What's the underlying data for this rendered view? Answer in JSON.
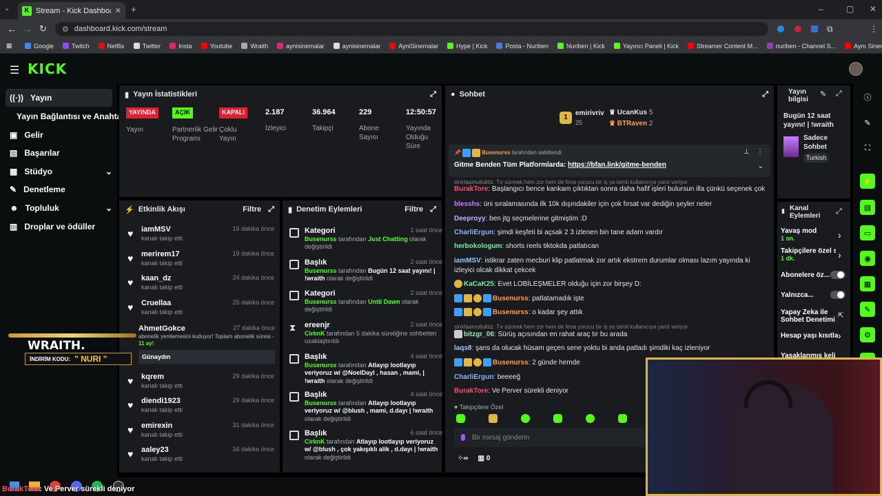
{
  "browser": {
    "tab_title": "Stream - Kick Dashboard",
    "url": "dashboard.kick.com/stream",
    "bookmarks": [
      "Google",
      "Twitch",
      "Netflix",
      "Twitter",
      "Insta",
      "Youtube",
      "Wraith",
      "aynisinemalar",
      "aynisinemalar",
      "AyniSinemalar",
      "Hype | Kick",
      "Posta - Nuriben",
      "Nuriben | Kick",
      "Yayıncı Paneli | Kick",
      "Streamer Content M...",
      "nuriben - Channel S...",
      "Aynı Sinemalar - Ça..."
    ]
  },
  "logo": "KICK",
  "sidebar": {
    "items": [
      "Yayın",
      "Yayın Bağlantısı ve Anahtarı",
      "Gelir",
      "Başarılar",
      "Stüdyo",
      "Denetleme",
      "Topluluk",
      "Droplar ve ödüller"
    ]
  },
  "stats": {
    "title": "Yayın İstatistikleri",
    "items": [
      {
        "badge": "YAYINDA",
        "label": "Yayın"
      },
      {
        "badge": "AÇIK",
        "label": "Partnerlik Gelir Programı"
      },
      {
        "badge": "KAPALI",
        "label": "Çoklu Yayın"
      },
      {
        "value": "2.187",
        "label": "İzleyici"
      },
      {
        "value": "36.964",
        "label": "Takipçi"
      },
      {
        "value": "229",
        "label": "Abone Sayısı"
      },
      {
        "value": "12:50:57",
        "label": "Yayında Olduğu Süre"
      }
    ]
  },
  "activity": {
    "title": "Etkinlik Akışı",
    "filter": "Filtre",
    "items": [
      {
        "name": "iamMSV",
        "sub": "kanalı takip etti",
        "time": "16 dakika önce"
      },
      {
        "name": "merirem17",
        "sub": "kanalı takip etti",
        "time": "19 dakika önce"
      },
      {
        "name": "kaan_dz",
        "sub": "kanalı takip etti",
        "time": "24 dakika önce"
      },
      {
        "name": "Cruellaa",
        "sub": "kanalı takip etti",
        "time": "25 dakika önce"
      }
    ],
    "sub_event": {
      "name": "AhmetGokce",
      "time": "27 dakika önce",
      "text": "abonelik yenilemesini kutluyor! Toplam abonelik süresi - ",
      "months": "11 ay!",
      "message": "Günaydın"
    },
    "items2": [
      {
        "name": "kqrem",
        "sub": "kanalı takip etti",
        "time": "29 dakika önce"
      },
      {
        "name": "diendi1923",
        "sub": "kanalı takip etti",
        "time": "29 dakika önce"
      },
      {
        "name": "emirexin",
        "sub": "kanalı takip etti",
        "time": "31 dakika önce"
      },
      {
        "name": "aaley23",
        "sub": "kanalı takip etti",
        "time": "34 dakika önce"
      }
    ]
  },
  "wraith": {
    "brand": "WRAITH.",
    "code_label": "İNDİRİM KODU:",
    "code": "\" NURI \""
  },
  "mod": {
    "title": "Denetim Eylemleri",
    "filter": "Filtre",
    "items": [
      {
        "title": "Kategori",
        "time": "1 saat önce",
        "actor": "Busenurss",
        "mid": " tarafından ",
        "value": "Just Chatting",
        "tail": " olarak değiştirildi"
      },
      {
        "title": "Başlık",
        "time": "2 saat önce",
        "actor": "Busenurss",
        "mid": " tarafından ",
        "value": "Bugün 12 saat yayını! | !wraith",
        "tail": " olarak değiştirildi"
      },
      {
        "title": "Kategori",
        "time": "2 saat önce",
        "actor": "Busenurss",
        "mid": " tarafından ",
        "value": "Until Dawn",
        "tail": " olarak değiştirildi"
      },
      {
        "title": "ereenjr",
        "time": "2 saat önce",
        "actor": "CirknK",
        "mid": " tarafından 5 dakika süreliğine sohbetten uzaklaştırıldı",
        "value": "",
        "tail": ""
      },
      {
        "title": "Başlık",
        "time": "4 saat önce",
        "actor": "Busenurss",
        "mid": " tarafından ",
        "value": "Atlayıp lootlayıp veriyoruz w/ @NoelDayl , hasan , mami, | !wraith",
        "tail": " olarak değiştirildi"
      },
      {
        "title": "Başlık",
        "time": "4 saat önce",
        "actor": "Busenurss",
        "mid": " tarafından ",
        "value": "Atlayıp lootlayıp veriyoruz w/ @blush , mami, d.dayı | !wraith",
        "tail": " olarak değiştirildi"
      },
      {
        "title": "Başlık",
        "time": "6 saat önce",
        "actor": "CirknK",
        "mid": " tarafından ",
        "value": "Atlayıp lootlayıp veriyoruz w/ @blush , çok yakışıklı alik , d.dayı | !wraith",
        "tail": " olarak değiştirildi"
      }
    ]
  },
  "chat": {
    "title": "Sohbet",
    "top": [
      {
        "name": "emirivriv",
        "count": "25"
      },
      {
        "name": "UcanKus",
        "count": "5"
      },
      {
        "name": "BTRaven",
        "count": "2"
      }
    ],
    "pinned": {
      "by": "Busenurss",
      "by_suffix": "tarafından sabitlendi",
      "text": "Gitme Benden Tüm Platformlarda: ",
      "link": "https://bfan.link/gitme-benden"
    },
    "messages": [
      {
        "sys": "sinirlaamutluktiz: Tır sürmek hem zor hem de fena yorucu bir iş ya isimli kullanıcıya yanıt veriyor"
      },
      {
        "user": "BurakTore",
        "color": "#ff4d6d",
        "text": "Başlangıcı bence kankam çıktıktan sonra daha hafif işleri bulursun illa çünkü seçenek çok"
      },
      {
        "user": "blesshs",
        "color": "#c77dff",
        "text": "üni sıralamasında ilk 10k dışındakiler için çok fırsat var dediğin şeyler neler"
      },
      {
        "user": "Deeproyy",
        "color": "#c7b3ff",
        "text": "ben jtg seçmelerine gitmiştim :D"
      },
      {
        "user": "CharliErgun",
        "color": "#8ab4ff",
        "text": "şimdi keşfeti bi açsak 2 3 izlenen bin tane adam vardır"
      },
      {
        "user": "herbokologum",
        "color": "#7ee8a2",
        "text": "shorts reels tiktokda patlatıcan"
      },
      {
        "user": "iamMSV",
        "color": "#8ecbff",
        "text": "istikrar zaten mecburi klip patlatmak zor artık ekstrem durumlar olması lazım yayında ki izleyici olcak dikkat çekcek"
      },
      {
        "user": "KaCaK25",
        "color": "#7ee8a2",
        "text": "Evet LOBİLEŞMELER olduğu için zor birşey D:"
      },
      {
        "user": "Busenurss",
        "color": "#ff9f43",
        "text": "patlatamadık işte"
      },
      {
        "user": "Busenurss",
        "color": "#ff9f43",
        "text": "o kadar şey attık"
      },
      {
        "sys": "sinirlaamutluktiz: Tır sürmek hem zor hem de fena yorucu bir iş ya isimli kullanıcıya yanıt veriyor"
      },
      {
        "user": "bitzgr_06",
        "color": "#9ae6b4",
        "text": "Sürüş açısından en rahat araç tır bu arada"
      },
      {
        "user": "laqs8",
        "color": "#a0c4ff",
        "text": "şans da olucak hüsam geçen sene yoktu bi anda patladı şimdiki kaç izleniyor"
      },
      {
        "user": "Busenurss",
        "color": "#ff9f43",
        "text": "2 günde hemde"
      },
      {
        "user": "CharliErgun",
        "color": "#8ab4ff",
        "text": "beeeeğ"
      },
      {
        "user": "BurakTore",
        "color": "#ff4d6d",
        "text": "Ve Perver sürekli deniyor"
      }
    ],
    "followers_only": "Takipçilere Özel",
    "input_placeholder": "Bir mesaj gönderin",
    "points": "0"
  },
  "stream_info": {
    "title": "Yayın bilgisi",
    "stream_title": "Bugün 12 saat yayını! | !wraith",
    "channel": "Sadece Sohbet",
    "language": "Turkish"
  },
  "channel_actions": {
    "title": "Kanal Eylemleri",
    "items": [
      {
        "label": "Yavaş mod",
        "sub": "1 sn."
      },
      {
        "label": "Takipçilere özel s",
        "sub": "1 dk."
      },
      {
        "label": "Abonelere öz..."
      },
      {
        "label": "Yalnızca..."
      },
      {
        "label": "Yapay Zeka ile Sohbet Denetimi"
      },
      {
        "label": "Hesap yaşı kısıtla"
      },
      {
        "label": "Yasaklanmış kelin"
      }
    ]
  },
  "overlay": {
    "user": "BurakTore",
    "text": ": Ve Perver sürekli deniyor"
  },
  "colors": {
    "kick_green": "#53fc18",
    "panel": "#191b1f",
    "live_red": "#e0202f"
  }
}
